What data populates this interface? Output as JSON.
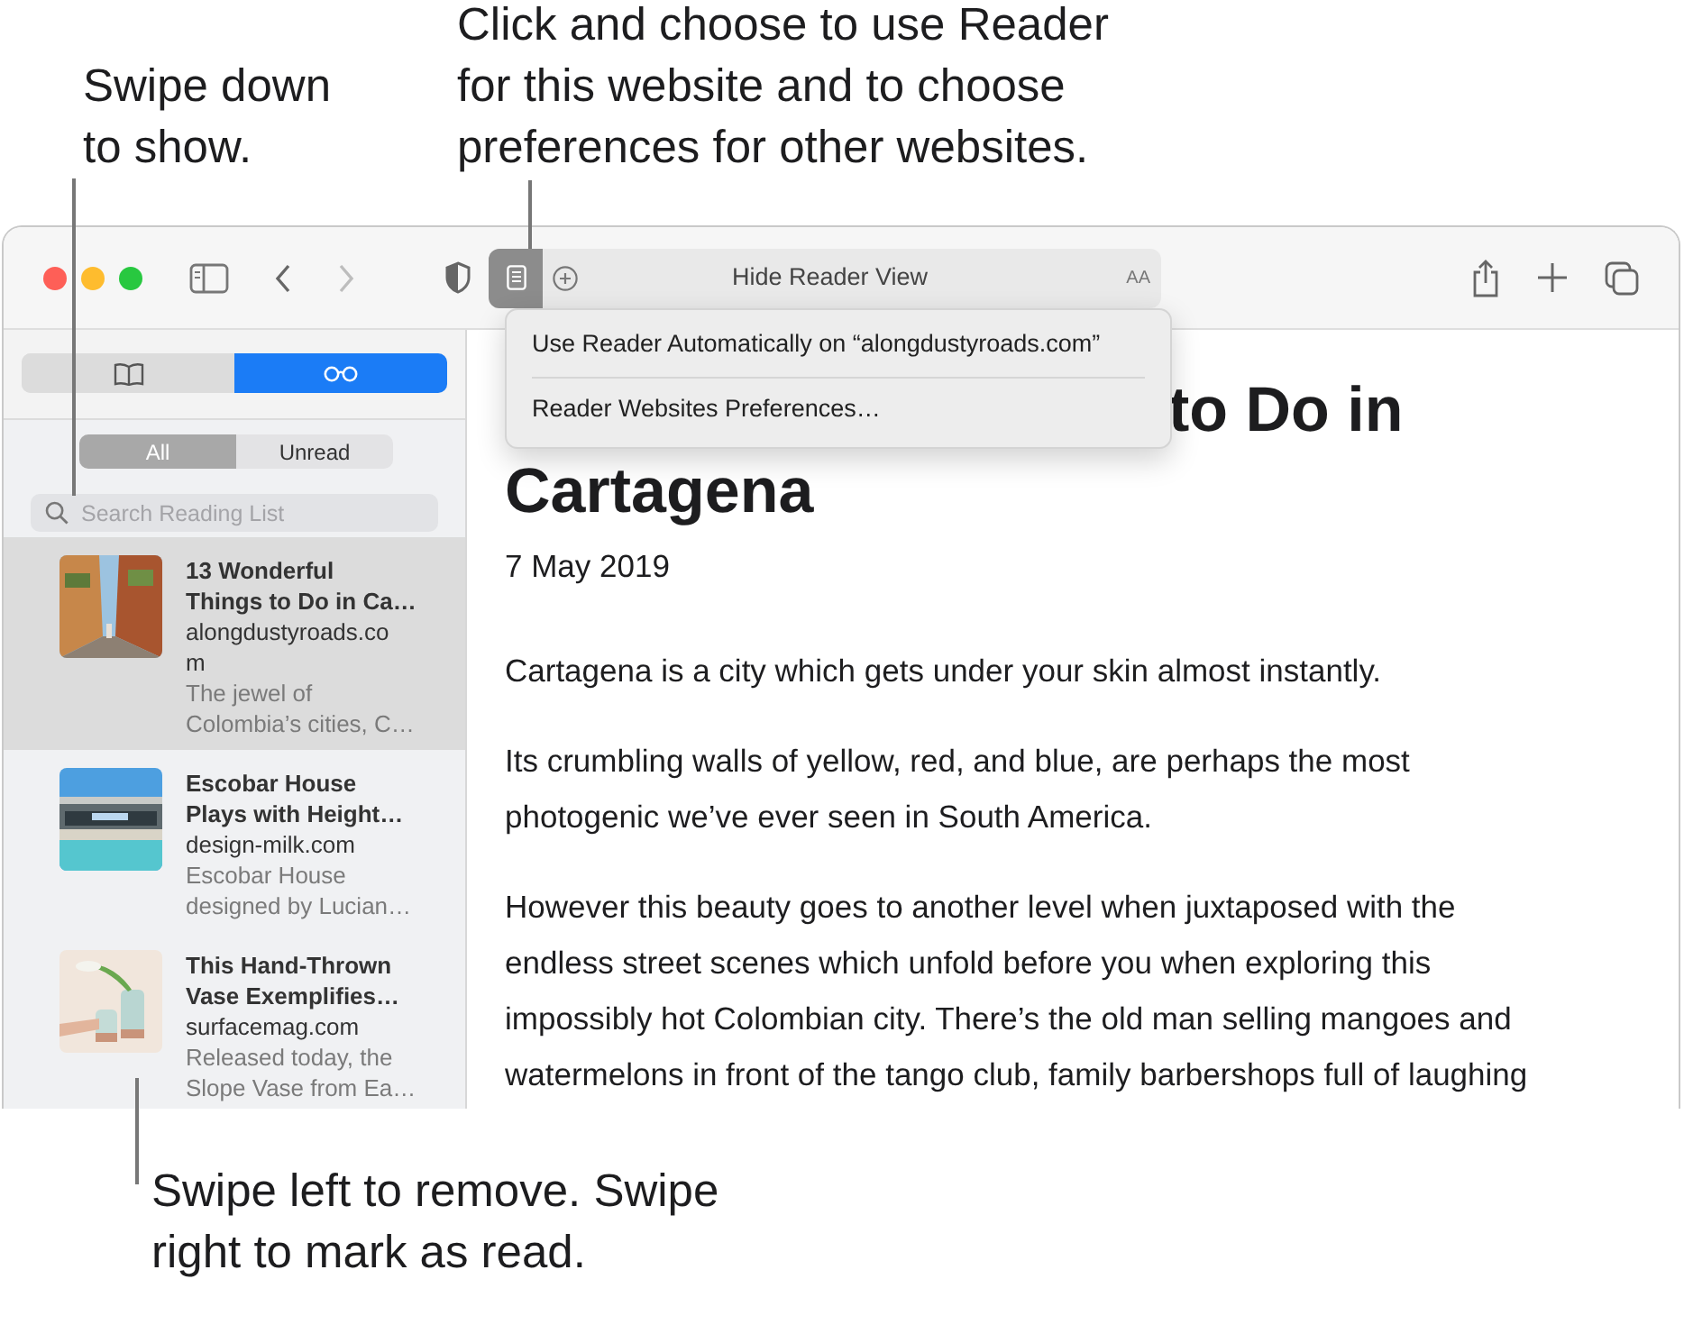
{
  "callouts": [
    {
      "kind": "top-left",
      "lines": [
        "Swipe down",
        "to show."
      ]
    },
    {
      "kind": "top-center",
      "lines": [
        "Click and choose to use Reader",
        "for this website and to choose",
        "preferences for other websites."
      ]
    },
    {
      "kind": "bottom",
      "lines": [
        "Swipe left to remove. Swipe",
        "right to mark as read."
      ]
    }
  ],
  "toolbar": {
    "forward_disabled": true,
    "reader_on": true,
    "address": "Hide Reader View",
    "text_size": "AA"
  },
  "reader_menu": {
    "items": [
      "Use Reader Automatically on “alongdustyroads.com”",
      "Reader Websites Preferences…"
    ]
  },
  "sidebar": {
    "tabs": [
      {
        "kind": "bookmarks",
        "selected": false
      },
      {
        "kind": "reading-list",
        "selected": true
      }
    ],
    "filters": [
      {
        "label": "All",
        "selected": true
      },
      {
        "label": "Unread",
        "selected": false
      }
    ],
    "search": {
      "placeholder": "Search Reading List"
    },
    "items": [
      {
        "title_lines": [
          "13 Wonderful",
          "Things to Do in Ca…"
        ],
        "site_lines": [
          "alongdustyroads.co",
          "m"
        ],
        "excerpt_lines": [
          "The jewel of",
          "Colombia’s cities, C…"
        ],
        "selected": true,
        "kind": "picture"
      },
      {
        "title_lines": [
          "Escobar House",
          "Plays with Height…"
        ],
        "site_lines": [
          "design-milk.com"
        ],
        "excerpt_lines": [
          "Escobar House",
          "designed by Lucian…"
        ],
        "selected": false,
        "kind": "picture"
      },
      {
        "title_lines": [
          "This Hand-Thrown",
          "Vase Exemplifies…"
        ],
        "site_lines": [
          "surfacemag.com"
        ],
        "excerpt_lines": [
          "Released today, the",
          "Slope Vase from Ea…"
        ],
        "selected": false,
        "kind": "picture"
      }
    ]
  },
  "article": {
    "heading_lines": [
      "to Do in",
      "Cartagena"
    ],
    "date": "7 May 2019",
    "paragraphs": [
      [
        "Cartagena is a city which gets under your skin almost instantly."
      ],
      [
        "Its crumbling walls of yellow, red, and blue, are perhaps the most",
        "photogenic we’ve ever seen in South America."
      ],
      [
        "However this beauty goes to another level when juxtaposed with the",
        "endless street scenes which unfold before you when exploring this",
        "impossibly hot Colombian city. There’s the old man selling mangoes and",
        "watermelons in front of the tango club, family barbershops full of laughing"
      ]
    ]
  }
}
